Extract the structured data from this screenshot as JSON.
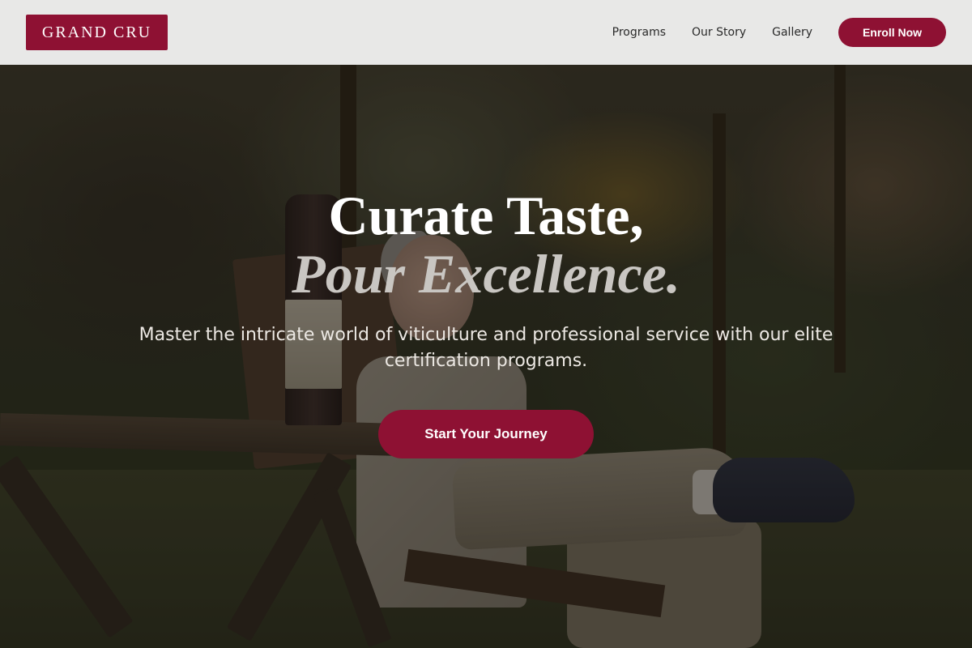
{
  "nav": {
    "logo_text": "GRAND CRU",
    "links": [
      {
        "label": "Programs"
      },
      {
        "label": "Our Story"
      },
      {
        "label": "Gallery"
      }
    ],
    "enroll_label": "Enroll Now"
  },
  "hero": {
    "headline_line1": "Curate Taste,",
    "headline_line2": "Pour Excellence.",
    "subtitle": "Master the intricate world of viticulture and professional service with our elite certification programs.",
    "cta_label": "Start Your Journey",
    "background_image_alt": "Man sitting in a wooden chair outdoors holding a glass of red wine beside a wine bottle"
  },
  "colors": {
    "brand": "#8e1133",
    "nav_background": "#f0f0f0",
    "text_light": "#ffffff"
  }
}
